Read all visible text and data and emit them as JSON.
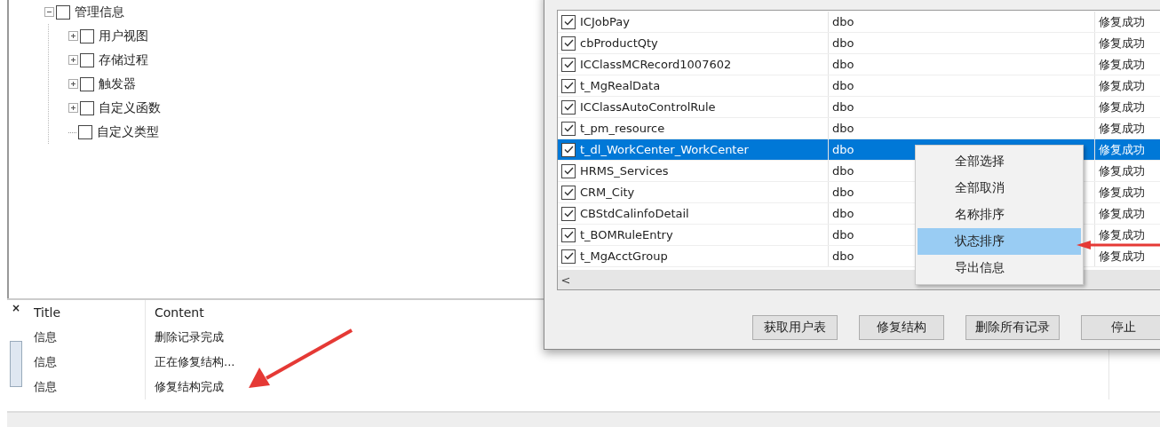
{
  "tree": {
    "label": "管理信息",
    "checked": false,
    "expanded": true,
    "children": [
      {
        "label": "用户视图",
        "checked": false,
        "kind": "folder"
      },
      {
        "label": "存储过程",
        "checked": false,
        "kind": "folder"
      },
      {
        "label": "触发器",
        "checked": false,
        "kind": "folder"
      },
      {
        "label": "自定义函数",
        "checked": false,
        "kind": "folder"
      },
      {
        "label": "自定义类型",
        "checked": false,
        "kind": "leaf"
      }
    ]
  },
  "messages": {
    "columns": [
      "Title",
      "Content"
    ],
    "rows": [
      {
        "title": "信息",
        "content": "删除记录完成"
      },
      {
        "title": "信息",
        "content": "正在修复结构..."
      },
      {
        "title": "信息",
        "content": "修复结构完成"
      }
    ]
  },
  "dialog": {
    "rows": [
      {
        "name": "ICJobPay",
        "schema": "dbo",
        "status": "修复成功",
        "checked": true,
        "selected": false
      },
      {
        "name": "cbProductQty",
        "schema": "dbo",
        "status": "修复成功",
        "checked": true,
        "selected": false
      },
      {
        "name": "ICClassMCRecord1007602",
        "schema": "dbo",
        "status": "修复成功",
        "checked": true,
        "selected": false
      },
      {
        "name": "t_MgRealData",
        "schema": "dbo",
        "status": "修复成功",
        "checked": true,
        "selected": false
      },
      {
        "name": "ICClassAutoControlRule",
        "schema": "dbo",
        "status": "修复成功",
        "checked": true,
        "selected": false
      },
      {
        "name": "t_pm_resource",
        "schema": "dbo",
        "status": "修复成功",
        "checked": true,
        "selected": false
      },
      {
        "name": "t_dl_WorkCenter_WorkCenter",
        "schema": "dbo",
        "status": "修复成功",
        "checked": true,
        "selected": true
      },
      {
        "name": "HRMS_Services",
        "schema": "dbo",
        "status": "修复成功",
        "checked": true,
        "selected": false
      },
      {
        "name": "CRM_City",
        "schema": "dbo",
        "status": "修复成功",
        "checked": true,
        "selected": false
      },
      {
        "name": "CBStdCalinfoDetail",
        "schema": "dbo",
        "status": "修复成功",
        "checked": true,
        "selected": false
      },
      {
        "name": "t_BOMRuleEntry",
        "schema": "dbo",
        "status": "修复成功",
        "checked": true,
        "selected": false
      },
      {
        "name": "t_MgAcctGroup",
        "schema": "dbo",
        "status": "修复成功",
        "checked": true,
        "selected": false
      }
    ],
    "scroll_left": "<",
    "buttons": [
      "获取用户表",
      "修复结构",
      "删除所有记录",
      "停止"
    ]
  },
  "context_menu": {
    "items": [
      {
        "label": "全部选择",
        "selected": false
      },
      {
        "label": "全部取消",
        "selected": false
      },
      {
        "label": "名称排序",
        "selected": false
      },
      {
        "label": "状态排序",
        "selected": true
      },
      {
        "label": "导出信息",
        "selected": false
      }
    ]
  },
  "panel_close": "×"
}
